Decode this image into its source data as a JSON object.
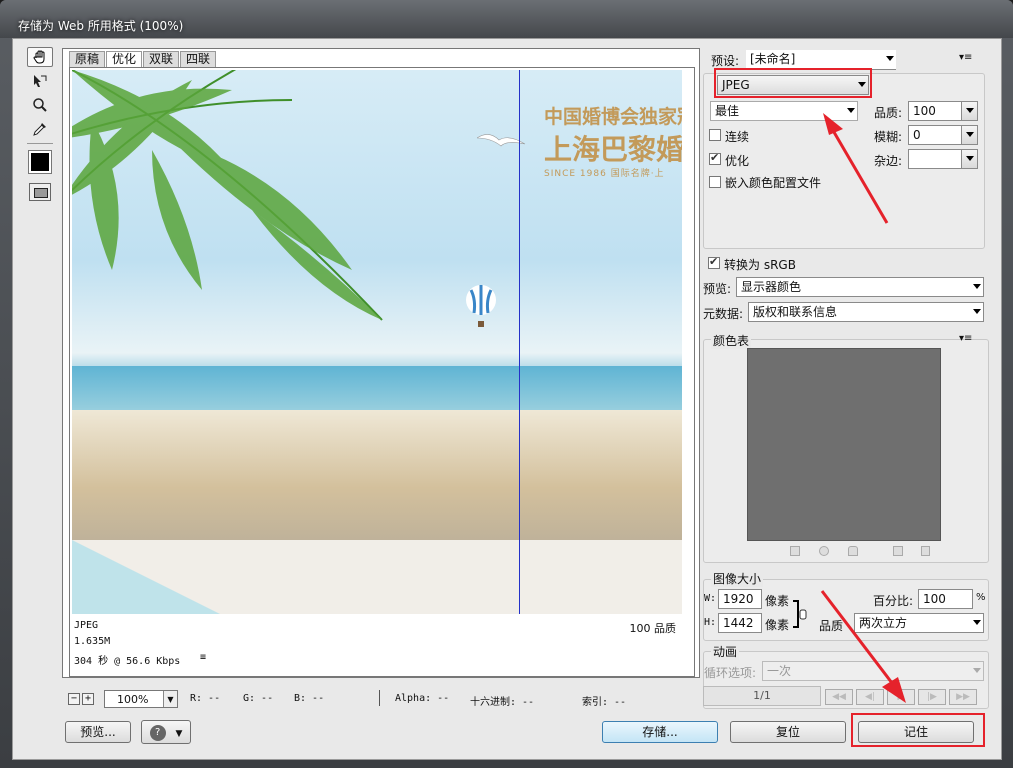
{
  "window": {
    "title": "存储为 Web 所用格式 (100%)"
  },
  "toolbox": {
    "tools": [
      "hand-icon",
      "slice-select-icon",
      "zoom-icon",
      "eyedropper-icon"
    ],
    "color": "#000000"
  },
  "tabs": [
    {
      "label": "原稿"
    },
    {
      "label": "优化"
    },
    {
      "label": "双联"
    },
    {
      "label": "四联"
    }
  ],
  "preview": {
    "image_text": {
      "line1": "中国婚博会独家冠",
      "line2": "上海巴黎婚",
      "line3": "SINCE 1986 国际名牌·上"
    },
    "info": {
      "format": "JPEG",
      "size": "1.635M",
      "time": "304 秒 @ 56.6 Kbps",
      "menu_icon": "≡",
      "quality": "100 品质"
    }
  },
  "status_bar": {
    "zoom": "100%",
    "r": "R: --",
    "g": "G: --",
    "b": "B: --",
    "alpha": "Alpha: --",
    "hex": "十六进制: --",
    "index": "索引: --"
  },
  "buttons": {
    "preview": "预览...",
    "save": "存储...",
    "reset": "复位",
    "remember": "记住"
  },
  "settings": {
    "preset_label": "预设:",
    "preset_value": "[未命名]",
    "format": "JPEG",
    "quality_level": "最佳",
    "quality_label": "品质:",
    "quality_value": "100",
    "progressive_label": "连续",
    "progressive": false,
    "blur_label": "模糊:",
    "blur_value": "0",
    "optimized_label": "优化",
    "optimized": true,
    "matte_label": "杂边:",
    "matte_value": "",
    "embed_profile_label": "嵌入颜色配置文件",
    "embed_profile": false,
    "convert_srgb_label": "转换为 sRGB",
    "convert_srgb": true,
    "preview_label": "预览:",
    "preview_value": "显示器颜色",
    "metadata_label": "元数据:",
    "metadata_value": "版权和联系信息"
  },
  "color_table": {
    "title": "颜色表",
    "icons": [
      "map-transparent-icon",
      "web-snap-icon",
      "lock-icon",
      "new-color-icon",
      "trash-icon"
    ]
  },
  "image_size": {
    "title": "图像大小",
    "w_label": "W:",
    "w_value": "1920",
    "h_label": "H:",
    "h_value": "1442",
    "unit": "像素",
    "percent_label": "百分比:",
    "percent_value": "100",
    "percent_unit": "%",
    "quality_label": "品质",
    "quality_value": "两次立方"
  },
  "animation": {
    "title": "动画",
    "loop_label": "循环选项:",
    "loop_value": "一次",
    "frame_counter": "1/1"
  },
  "accent": "#e5222b"
}
